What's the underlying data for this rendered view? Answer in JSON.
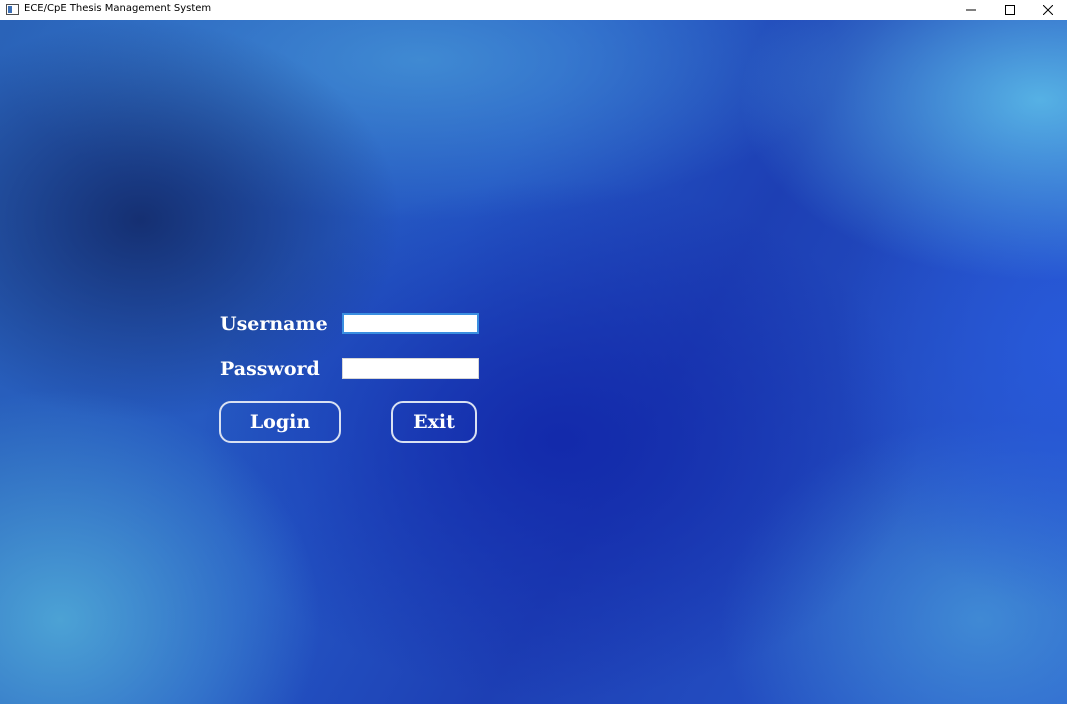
{
  "window": {
    "title": "ECE/CpE Thesis Management System",
    "icon": "app-window-icon",
    "controls": {
      "minimize_icon": "minimize-icon",
      "maximize_icon": "maximize-icon",
      "close_icon": "close-icon"
    }
  },
  "login": {
    "username_label": "Username",
    "username_value": "",
    "password_label": "Password",
    "password_value": "",
    "login_button": "Login",
    "exit_button": "Exit"
  },
  "colors": {
    "background_primary": "#1d3fb4",
    "background_accent": "#5fc3eb",
    "label_text": "#ffffff",
    "button_border": "#d9e1f2",
    "focus_border": "#3a8ee0"
  }
}
